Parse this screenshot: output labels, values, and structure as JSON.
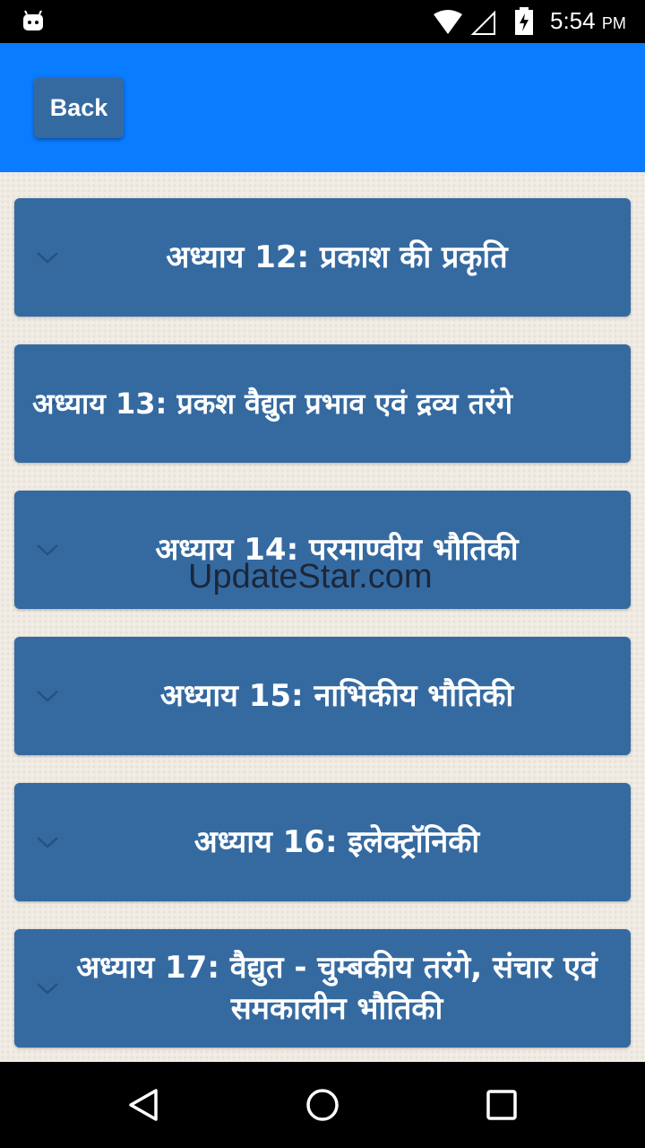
{
  "status_bar": {
    "time": "5:54",
    "ampm": "PM",
    "icons": [
      "android-app-icon",
      "wifi-icon",
      "signal-icon",
      "battery-charging-icon"
    ]
  },
  "header": {
    "back_label": "Back",
    "background_color": "#0a7cff",
    "button_color": "#356aa1"
  },
  "chapters": [
    {
      "title": "अध्याय 12: प्रकाश की प्रकृति"
    },
    {
      "title": "अध्याय 13: प्रकश वैद्युत प्रभाव एवं द्रव्य तरंगे"
    },
    {
      "title": "अध्याय 14: परमाण्वीय भौतिकी"
    },
    {
      "title": "अध्याय 15: नाभिकीय भौतिकी"
    },
    {
      "title": "अध्याय 16: इलेक्ट्रॉनिकी"
    },
    {
      "title": "अध्याय 17: वैद्युत - चुम्बकीय तरंगे, संचार एवं समकालीन भौतिकी"
    }
  ],
  "watermark": "UpdateStar.com",
  "nav_bar": {
    "icons": [
      "back-triangle-icon",
      "home-circle-icon",
      "recents-square-icon"
    ]
  }
}
